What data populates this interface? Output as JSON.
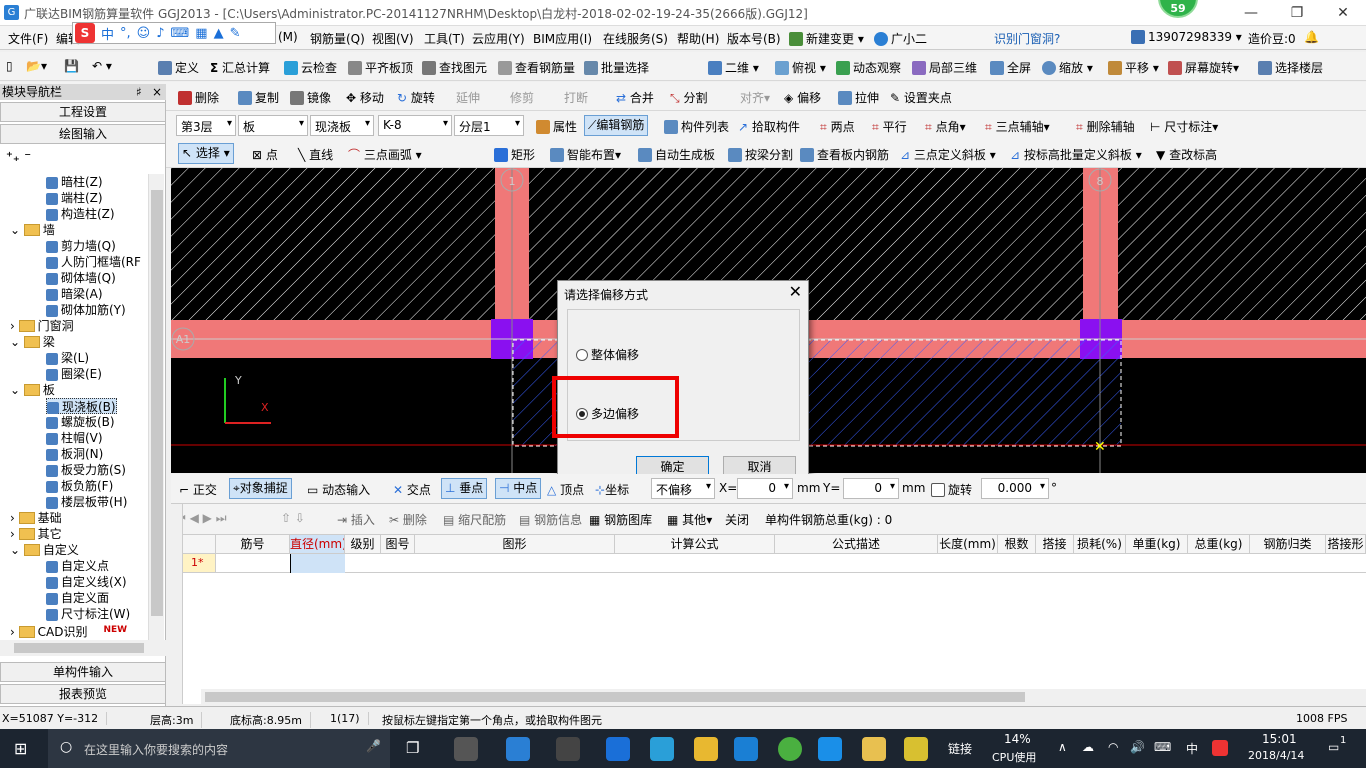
{
  "title": "广联达BIM钢筋算量软件 GGJ2013 - [C:\\Users\\Administrator.PC-20141127NRHM\\Desktop\\白龙村-2018-02-02-19-24-35(2666版).GGJ12]",
  "badge": "59",
  "menu": [
    "文件(F)",
    "编辑",
    "(M)",
    "钢筋量(Q)",
    "视图(V)",
    "工具(T)",
    "云应用(Y)",
    "BIM应用(I)",
    "在线服务(S)",
    "帮助(H)",
    "版本号(B)",
    "新建变更",
    "广小二",
    "识别门窗洞?",
    "13907298339",
    "造价豆:0"
  ],
  "ime": {
    "s": "S",
    "zh": "中"
  },
  "toolbar1": [
    "定义",
    "汇总计算",
    "云检查",
    "平齐板顶",
    "查找图元",
    "查看钢筋量",
    "批量选择",
    "二维",
    "俯视",
    "动态观察",
    "局部三维",
    "全屏",
    "缩放",
    "平移",
    "屏幕旋转",
    "选择楼层"
  ],
  "toolbar2": {
    "panel_title": "模块导航栏",
    "pin": "♯",
    "close": "×",
    "items": [
      "删除",
      "复制",
      "镜像",
      "移动",
      "旋转",
      "延伸",
      "修剪",
      "打断",
      "合并",
      "分割",
      "对齐",
      "偏移",
      "拉伸",
      "设置夹点"
    ]
  },
  "toolbar3": {
    "floor": "第3层",
    "type": "板",
    "sub": "现浇板",
    "code": "K-8",
    "layer": "分层1",
    "items": [
      "属性",
      "编辑钢筋",
      "构件列表",
      "拾取构件",
      "两点",
      "平行",
      "点角",
      "三点辅轴",
      "删除辅轴",
      "尺寸标注"
    ]
  },
  "toolbar4": [
    "选择",
    "点",
    "直线",
    "三点画弧",
    "矩形",
    "智能布置",
    "自动生成板",
    "按梁分割",
    "查看板内钢筋",
    "三点定义斜板",
    "按标高批量定义斜板",
    "查改标高"
  ],
  "left": {
    "h1": "工程设置",
    "h2": "绘图输入",
    "h3": "单构件输入",
    "h4": "报表预览",
    "tree": [
      {
        "t": "暗柱(Z)",
        "l": 2
      },
      {
        "t": "端柱(Z)",
        "l": 2
      },
      {
        "t": "构造柱(Z)",
        "l": 2
      },
      {
        "t": "墙",
        "l": 1
      },
      {
        "t": "剪力墙(Q)",
        "l": 2
      },
      {
        "t": "人防门框墙(RF",
        "l": 2
      },
      {
        "t": "砌体墙(Q)",
        "l": 2
      },
      {
        "t": "暗梁(A)",
        "l": 2
      },
      {
        "t": "砌体加筋(Y)",
        "l": 2
      },
      {
        "t": "门窗洞",
        "l": 1
      },
      {
        "t": "梁",
        "l": 1
      },
      {
        "t": "梁(L)",
        "l": 2
      },
      {
        "t": "圈梁(E)",
        "l": 2
      },
      {
        "t": "板",
        "l": 1
      },
      {
        "t": "现浇板(B)",
        "l": 2
      },
      {
        "t": "螺旋板(B)",
        "l": 2
      },
      {
        "t": "柱帽(V)",
        "l": 2
      },
      {
        "t": "板洞(N)",
        "l": 2
      },
      {
        "t": "板受力筋(S)",
        "l": 2
      },
      {
        "t": "板负筋(F)",
        "l": 2
      },
      {
        "t": "楼层板带(H)",
        "l": 2
      },
      {
        "t": "基础",
        "l": 1
      },
      {
        "t": "其它",
        "l": 1
      },
      {
        "t": "自定义",
        "l": 1
      },
      {
        "t": "自定义点",
        "l": 2
      },
      {
        "t": "自定义线(X)",
        "l": 2
      },
      {
        "t": "自定义面",
        "l": 2
      },
      {
        "t": "尺寸标注(W)",
        "l": 2
      },
      {
        "t": "CAD识别",
        "l": 1
      }
    ],
    "new": "NEW"
  },
  "canvas": {
    "axis_a": "A1",
    "axis_top1": "1",
    "axis_top2": "8",
    "y": "Y",
    "x": "X"
  },
  "dialog": {
    "title": "请选择偏移方式",
    "opt1": "整体偏移",
    "opt2": "多边偏移",
    "ok": "确定",
    "cancel": "取消"
  },
  "snap": {
    "items": [
      "正交",
      "对象捕捉",
      "动态输入",
      "交点",
      "垂点",
      "中点",
      "顶点",
      "坐标",
      "不偏移"
    ],
    "x_label": "X=",
    "x_val": "0",
    "mm1": "mm",
    "y_label": "Y=",
    "y_val": "0",
    "mm2": "mm",
    "rotate": "旋转",
    "rot_val": "0.000",
    "deg": "°"
  },
  "gridtool": [
    "插入",
    "删除",
    "缩尺配筋",
    "钢筋信息",
    "钢筋图库",
    "其他",
    "关闭",
    "单构件钢筋总重(kg) : 0"
  ],
  "grid": {
    "cols": [
      "筋号",
      "直径(mm)",
      "级别",
      "图号",
      "图形",
      "计算公式",
      "公式描述",
      "长度(mm)",
      "根数",
      "搭接",
      "损耗(%)",
      "单重(kg)",
      "总重(kg)",
      "钢筋归类",
      "搭接形"
    ],
    "row1": "1*"
  },
  "status": [
    "X=51087 Y=-312",
    "层高:3m",
    "底标高:8.95m",
    "1(17)",
    "按鼠标左键指定第一个角点，或拾取构件图元",
    "1008 FPS"
  ],
  "taskbar": {
    "search": "在这里输入你要搜索的内容",
    "link": "链接",
    "cpu": "14%",
    "cpu_label": "CPU使用",
    "lang": "中",
    "time": "15:01",
    "date": "2018/4/14",
    "notif": "1"
  }
}
